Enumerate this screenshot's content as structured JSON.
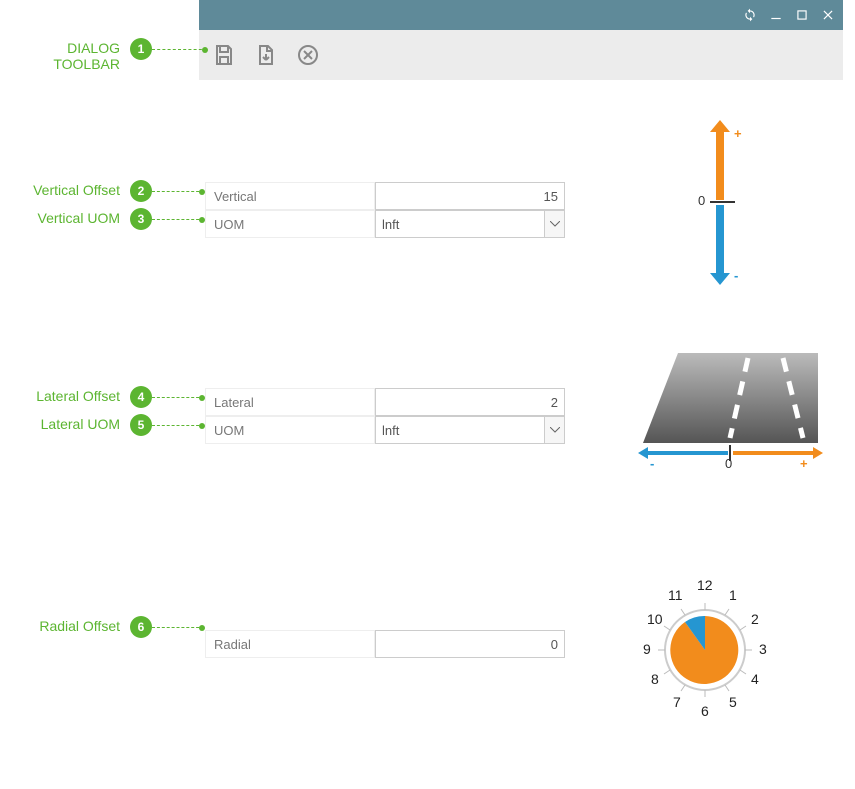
{
  "titlebar": {},
  "toolbar": {
    "callout_label": "DIALOG TOOLBAR",
    "callout_num": "1"
  },
  "callouts": {
    "vertical_offset": {
      "label": "Vertical Offset",
      "num": "2"
    },
    "vertical_uom": {
      "label": "Vertical UOM",
      "num": "3"
    },
    "lateral_offset": {
      "label": "Lateral Offset",
      "num": "4"
    },
    "lateral_uom": {
      "label": "Lateral UOM",
      "num": "5"
    },
    "radial_offset": {
      "label": "Radial Offset",
      "num": "6"
    }
  },
  "form": {
    "vertical": {
      "label": "Vertical",
      "value": "15"
    },
    "vertical_uom": {
      "label": "UOM",
      "value": "lnft"
    },
    "lateral": {
      "label": "Lateral",
      "value": "2"
    },
    "lateral_uom": {
      "label": "UOM",
      "value": "lnft"
    },
    "radial": {
      "label": "Radial",
      "value": "0"
    }
  },
  "diagrams": {
    "vertical": {
      "plus": "+",
      "minus": "-",
      "zero": "0"
    },
    "lateral": {
      "plus": "+",
      "minus": "-",
      "zero": "0"
    },
    "radial_clock": [
      "12",
      "1",
      "2",
      "3",
      "4",
      "5",
      "6",
      "7",
      "8",
      "9",
      "10",
      "11"
    ]
  },
  "colors": {
    "accent": "#5cb531",
    "orange": "#f28c1c",
    "blue": "#2596d1",
    "titlebar": "#5f8a99"
  }
}
